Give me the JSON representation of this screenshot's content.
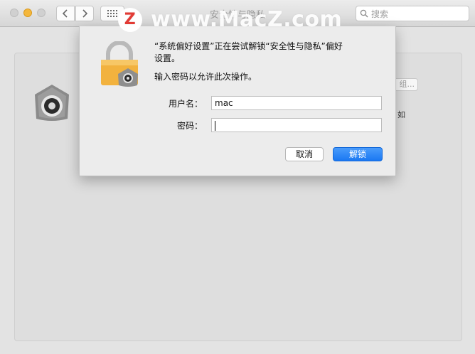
{
  "window": {
    "title": "安全性与隐私",
    "search_placeholder": "搜索"
  },
  "dialog": {
    "message_line1": "“系统偏好设置”正在尝试解锁“安全性与隐私”偏好",
    "message_line2": "设置。",
    "instruction": "输入密码以允许此次操作。",
    "username_label": "用户名：",
    "username_value": "mac",
    "password_label": "密码：",
    "password_value": "",
    "cancel_label": "取消",
    "unlock_label": "解锁"
  },
  "background": {
    "button_label": "组...",
    "side_text": "。如"
  },
  "watermark": {
    "logo_letter": "Z",
    "text": "www.MacZ.com"
  },
  "colors": {
    "accent": "#1a78f2",
    "lock_body": "#f2b23e",
    "close_light": "#d0d0d0",
    "minimize_light": "#f4b73c"
  },
  "icons": [
    "chevron-left-icon",
    "chevron-right-icon",
    "grid-icon",
    "search-icon",
    "lock-icon"
  ]
}
